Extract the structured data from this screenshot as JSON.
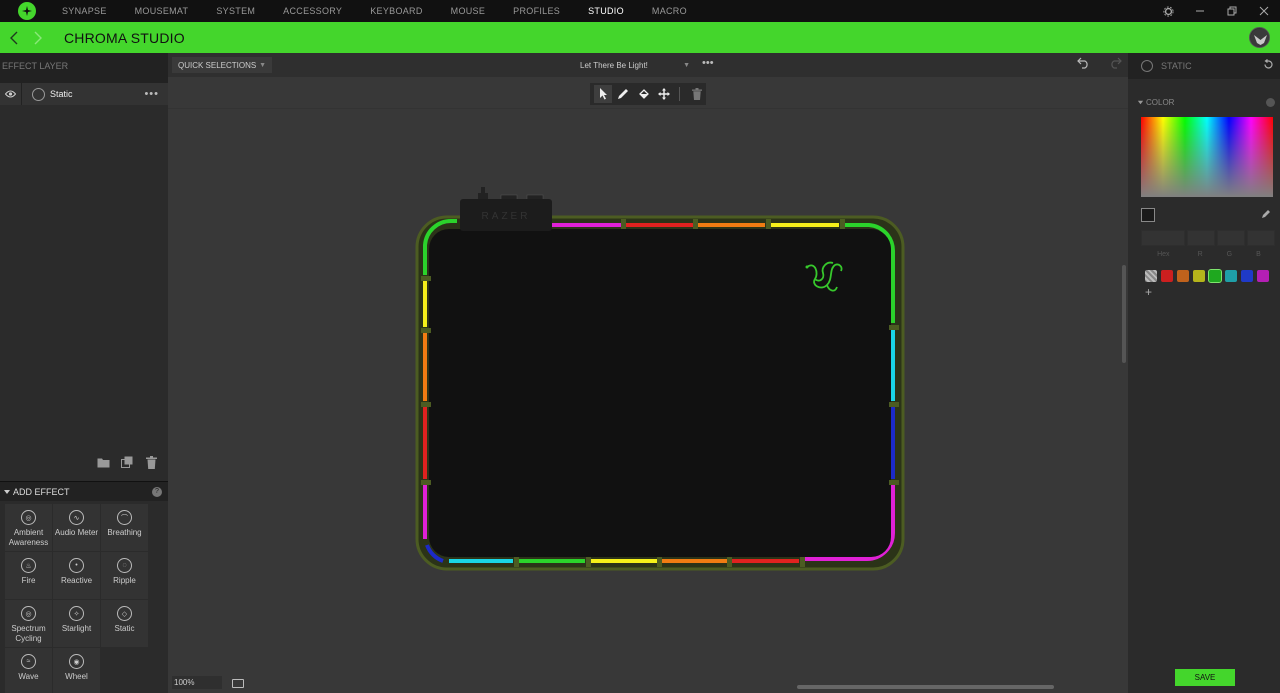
{
  "nav": {
    "items": [
      "SYNAPSE",
      "MOUSEMAT",
      "SYSTEM",
      "ACCESSORY",
      "KEYBOARD",
      "MOUSE",
      "PROFILES",
      "STUDIO",
      "MACRO"
    ],
    "active": "STUDIO"
  },
  "header": {
    "title": "CHROMA STUDIO"
  },
  "left": {
    "title": "EFFECT LAYER",
    "layer_name": "Static",
    "add_effect_title": "ADD EFFECT",
    "effects": [
      [
        "Ambient",
        "Awareness"
      ],
      [
        "Audio Meter"
      ],
      [
        "Breathing"
      ],
      [
        "Fire"
      ],
      [
        "Reactive"
      ],
      [
        "Ripple"
      ],
      [
        "Spectrum",
        "Cycling"
      ],
      [
        "Starlight"
      ],
      [
        "Static"
      ],
      [
        "Wave"
      ],
      [
        "Wheel"
      ]
    ]
  },
  "center": {
    "quick_selections": "QUICK SELECTIONS",
    "preset_name": "Let There Be Light!",
    "zoom": "100%",
    "device_brand": "RAZER"
  },
  "right": {
    "title": "STATIC",
    "color_title": "COLOR",
    "input_labels": [
      "Hex",
      "R",
      "G",
      "B"
    ],
    "preset_colors": [
      "#cc1f1f",
      "#c0621c",
      "#b5b41b",
      "#1fa81f",
      "#1f9fa8",
      "#1f3ac8",
      "#b41fb4"
    ],
    "save_label": "SAVE"
  },
  "colors": {
    "accent": "#44d62c"
  }
}
